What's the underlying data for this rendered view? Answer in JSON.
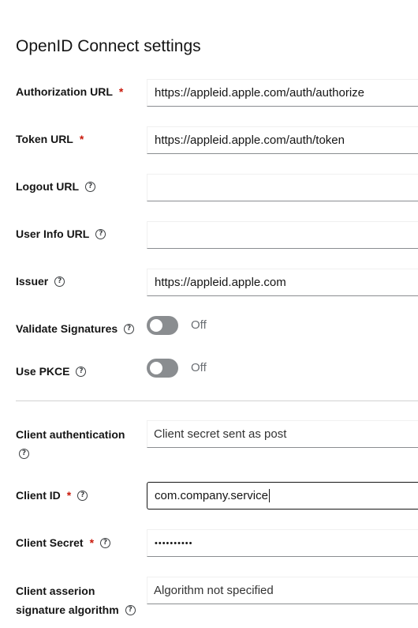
{
  "section_title": "OpenID Connect settings",
  "fields": {
    "authorization_url": {
      "label": "Authorization URL",
      "required_mark": "*",
      "value": "https://appleid.apple.com/auth/authorize"
    },
    "token_url": {
      "label": "Token URL",
      "required_mark": "*",
      "value": "https://appleid.apple.com/auth/token"
    },
    "logout_url": {
      "label": "Logout URL",
      "help": "?",
      "value": ""
    },
    "user_info_url": {
      "label": "User Info URL",
      "help": "?",
      "value": ""
    },
    "issuer": {
      "label": "Issuer",
      "help": "?",
      "value": "https://appleid.apple.com"
    },
    "validate_signatures": {
      "label": "Validate Signatures",
      "help": "?",
      "state": "Off"
    },
    "use_pkce": {
      "label": "Use PKCE",
      "help": "?",
      "state": "Off"
    },
    "client_authentication": {
      "label": "Client authentication",
      "help": "?",
      "value": "Client secret sent as post"
    },
    "client_id": {
      "label": "Client ID",
      "required_mark": "*",
      "help": "?",
      "value": "com.company.service"
    },
    "client_secret": {
      "label": "Client Secret",
      "required_mark": "*",
      "help": "?",
      "value": "••••••••••"
    },
    "client_assertion_alg": {
      "label_line1": "Client asserion",
      "label_line2": "signature algorithm",
      "help": "?",
      "value": "Algorithm not specified"
    }
  },
  "icons": {
    "help": "question-circle-icon",
    "toggle": "switch"
  },
  "colors": {
    "required": "#c9190b",
    "toggle_off": "#8a8d90",
    "divider": "#d2d2d2"
  }
}
